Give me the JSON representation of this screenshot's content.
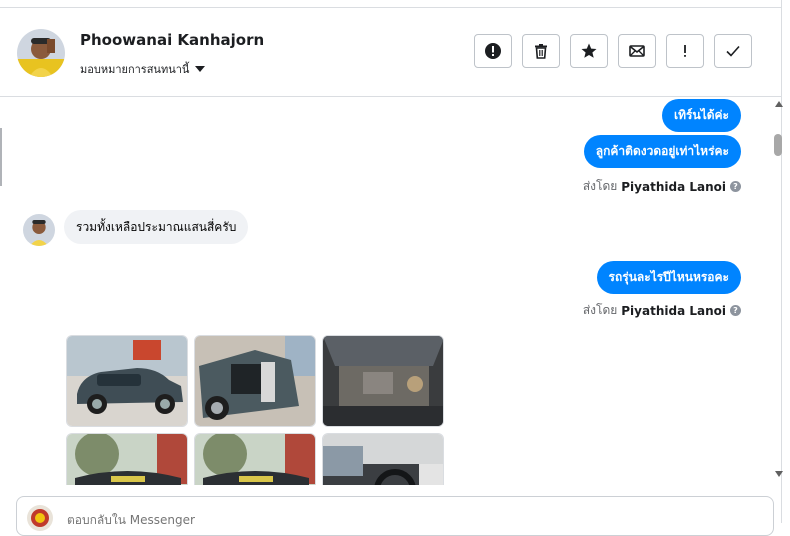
{
  "header": {
    "name": "Phoowanai Kanhajorn",
    "assign_label": "มอบหมายการสนทนานี้"
  },
  "toolbar": [
    {
      "name": "spam-button",
      "icon": "exclamation-circle-icon"
    },
    {
      "name": "delete-button",
      "icon": "trash-icon"
    },
    {
      "name": "star-button",
      "icon": "star-icon"
    },
    {
      "name": "mark-unread-button",
      "icon": "envelope-icon"
    },
    {
      "name": "follow-up-button",
      "icon": "exclamation-icon"
    },
    {
      "name": "done-button",
      "icon": "check-icon"
    }
  ],
  "messages": {
    "out1": "เทิร์นได้ค่ะ",
    "out2": "ลูกค้าติดงวดอยู่เท่าไหร่คะ",
    "sent_by_prefix": "ส่งโดย",
    "sent_by_name": "Piyathida Lanoi",
    "in1": "รวมทั้งเหลือประมาณแสนสี่ครับ",
    "out3": "รถรุ่นละไรปีไหนหรอคะ"
  },
  "composer": {
    "placeholder": "ตอบกลับใน Messenger"
  },
  "colors": {
    "accent": "#0084ff",
    "incoming_bubble": "#f0f2f5",
    "border": "#dadde1"
  }
}
